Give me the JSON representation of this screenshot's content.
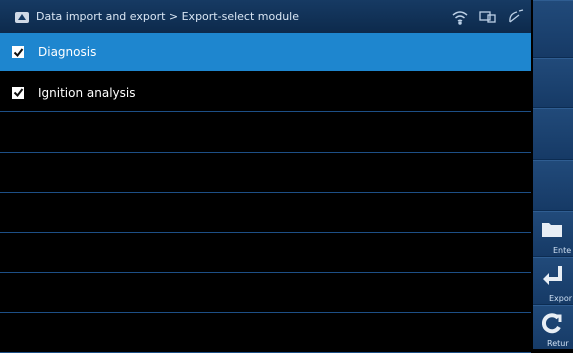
{
  "header": {
    "breadcrumb": "Data import and export > Export-select module"
  },
  "modules": [
    {
      "label": "Diagnosis",
      "checked": true,
      "selected": true
    },
    {
      "label": "Ignition analysis",
      "checked": true,
      "selected": false
    }
  ],
  "sidebar": {
    "enter_label": "Ente",
    "export_label": "Expor",
    "return_label": "Retur"
  },
  "colors": {
    "accent": "#1e86cf",
    "titlebar": "#163a63",
    "background": "#000000",
    "divider": "#1d4f86"
  },
  "icons": [
    "app-logo-icon",
    "wifi-icon",
    "device-link-icon",
    "satellite-dish-icon",
    "folder-icon",
    "enter-arrow-icon",
    "refresh-icon",
    "checkmark-icon"
  ]
}
